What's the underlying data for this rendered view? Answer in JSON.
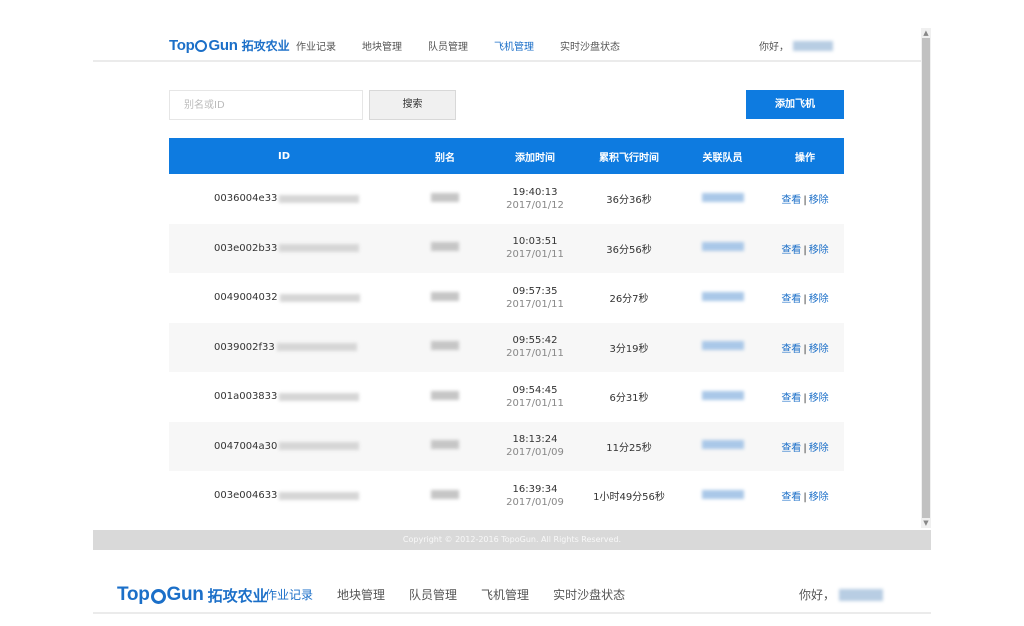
{
  "brand": {
    "name_en_1": "Top",
    "name_en_2": "Gun",
    "name_cn": "拓攻农业",
    "color": "#1b6fc8"
  },
  "nav": {
    "items": [
      {
        "label": "作业记录",
        "active": false
      },
      {
        "label": "地块管理",
        "active": false
      },
      {
        "label": "队员管理",
        "active": false
      },
      {
        "label": "飞机管理",
        "active": true
      },
      {
        "label": "实时沙盘状态",
        "active": false
      }
    ],
    "greeting": "你好，"
  },
  "bottom_nav": {
    "items": [
      {
        "label": "作业记录",
        "active": true
      },
      {
        "label": "地块管理",
        "active": false
      },
      {
        "label": "队员管理",
        "active": false
      },
      {
        "label": "飞机管理",
        "active": false
      },
      {
        "label": "实时沙盘状态",
        "active": false
      }
    ],
    "greeting": "你好，"
  },
  "toolbar": {
    "search_placeholder": "别名或ID",
    "search_label": "搜索",
    "add_label": "添加飞机",
    "accent": "#0e7be0"
  },
  "table": {
    "headers": {
      "id": "ID",
      "alias": "别名",
      "added": "添加时间",
      "duration": "累积飞行时间",
      "team": "关联队员",
      "ops": "操作"
    },
    "rows": [
      {
        "id": "0036004e33",
        "time": "19:40:13",
        "date": "2017/01/12",
        "duration": "36分36秒",
        "view": "查看",
        "remove": "移除"
      },
      {
        "id": "003e002b33",
        "time": "10:03:51",
        "date": "2017/01/11",
        "duration": "36分56秒",
        "view": "查看",
        "remove": "移除"
      },
      {
        "id": "0049004032",
        "time": "09:57:35",
        "date": "2017/01/11",
        "duration": "26分7秒",
        "view": "查看",
        "remove": "移除"
      },
      {
        "id": "0039002f33",
        "time": "09:55:42",
        "date": "2017/01/11",
        "duration": "3分19秒",
        "view": "查看",
        "remove": "移除"
      },
      {
        "id": "001a003833",
        "time": "09:54:45",
        "date": "2017/01/11",
        "duration": "6分31秒",
        "view": "查看",
        "remove": "移除"
      },
      {
        "id": "0047004a30",
        "time": "18:13:24",
        "date": "2017/01/09",
        "duration": "11分25秒",
        "view": "查看",
        "remove": "移除"
      },
      {
        "id": "003e004633",
        "time": "16:39:34",
        "date": "2017/01/09",
        "duration": "1小时49分56秒",
        "view": "查看",
        "remove": "移除"
      }
    ],
    "separator": "|"
  },
  "footer": {
    "copyright": "Copyright © 2012-2016 TopoGun. All Rights Reserved."
  }
}
